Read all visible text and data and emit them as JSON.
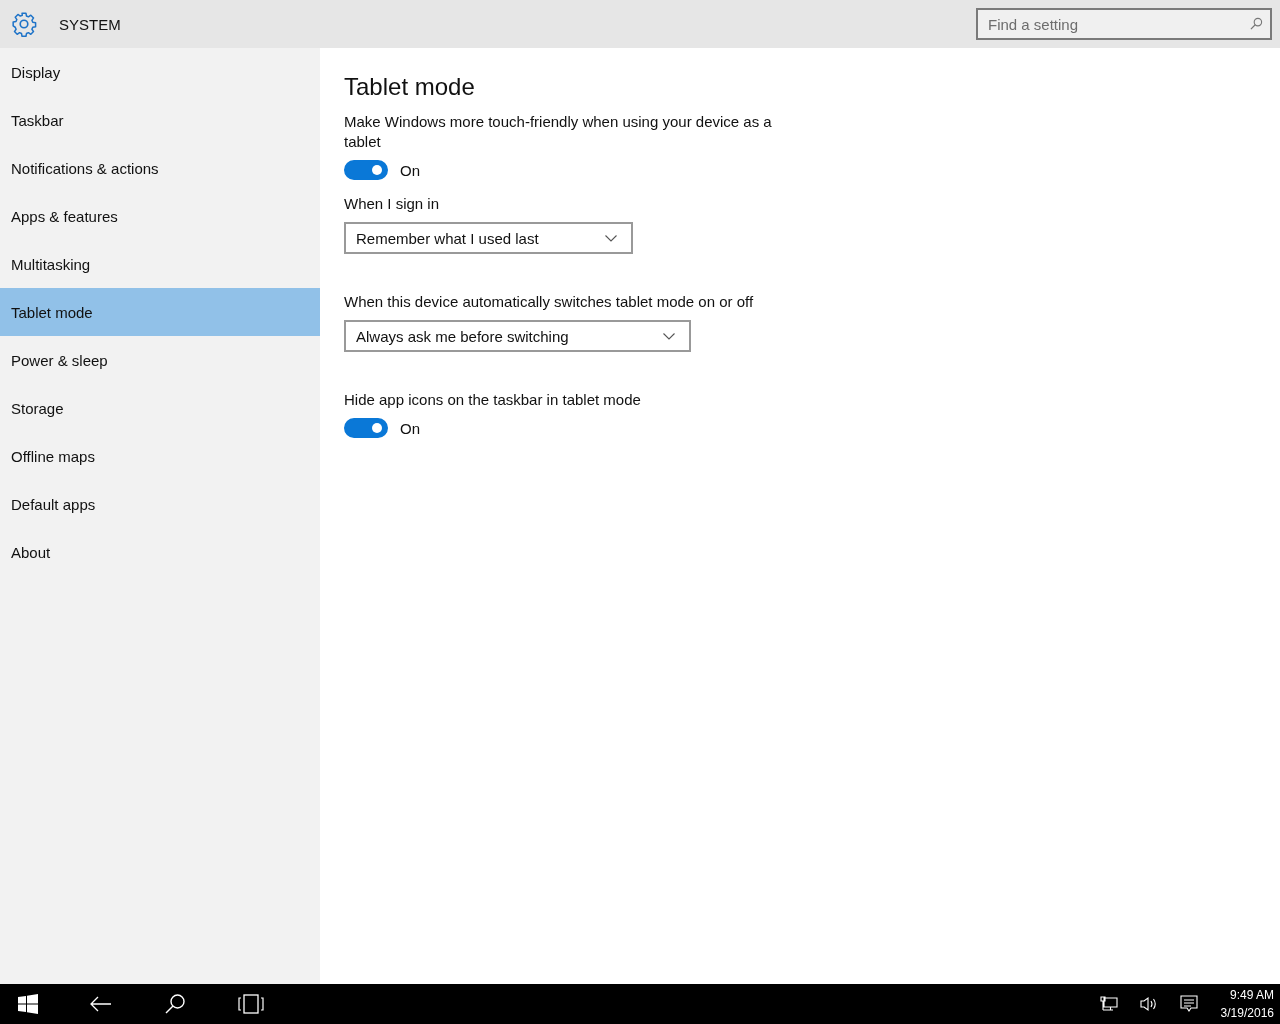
{
  "header": {
    "title": "SYSTEM",
    "search": {
      "placeholder": "Find a setting"
    }
  },
  "sidebar": {
    "items": [
      {
        "label": "Display",
        "selected": false
      },
      {
        "label": "Taskbar",
        "selected": false
      },
      {
        "label": "Notifications & actions",
        "selected": false
      },
      {
        "label": "Apps & features",
        "selected": false
      },
      {
        "label": "Multitasking",
        "selected": false
      },
      {
        "label": "Tablet mode",
        "selected": true
      },
      {
        "label": "Power & sleep",
        "selected": false
      },
      {
        "label": "Storage",
        "selected": false
      },
      {
        "label": "Offline maps",
        "selected": false
      },
      {
        "label": "Default apps",
        "selected": false
      },
      {
        "label": "About",
        "selected": false
      }
    ]
  },
  "content": {
    "title": "Tablet mode",
    "settings": [
      {
        "kind": "toggle",
        "label": "Make Windows more touch-friendly when using your device as a tablet",
        "on": true,
        "state_text": "On"
      },
      {
        "kind": "dropdown",
        "label": "When I sign in",
        "value": "Remember what I used last"
      },
      {
        "kind": "dropdown",
        "label": "When this device automatically switches tablet mode on or off",
        "value": "Always ask me before switching"
      },
      {
        "kind": "toggle",
        "label": "Hide app icons on the taskbar in tablet mode",
        "on": true,
        "state_text": "On"
      }
    ]
  },
  "taskbar": {
    "time": "9:49 AM",
    "date": "3/19/2016"
  }
}
